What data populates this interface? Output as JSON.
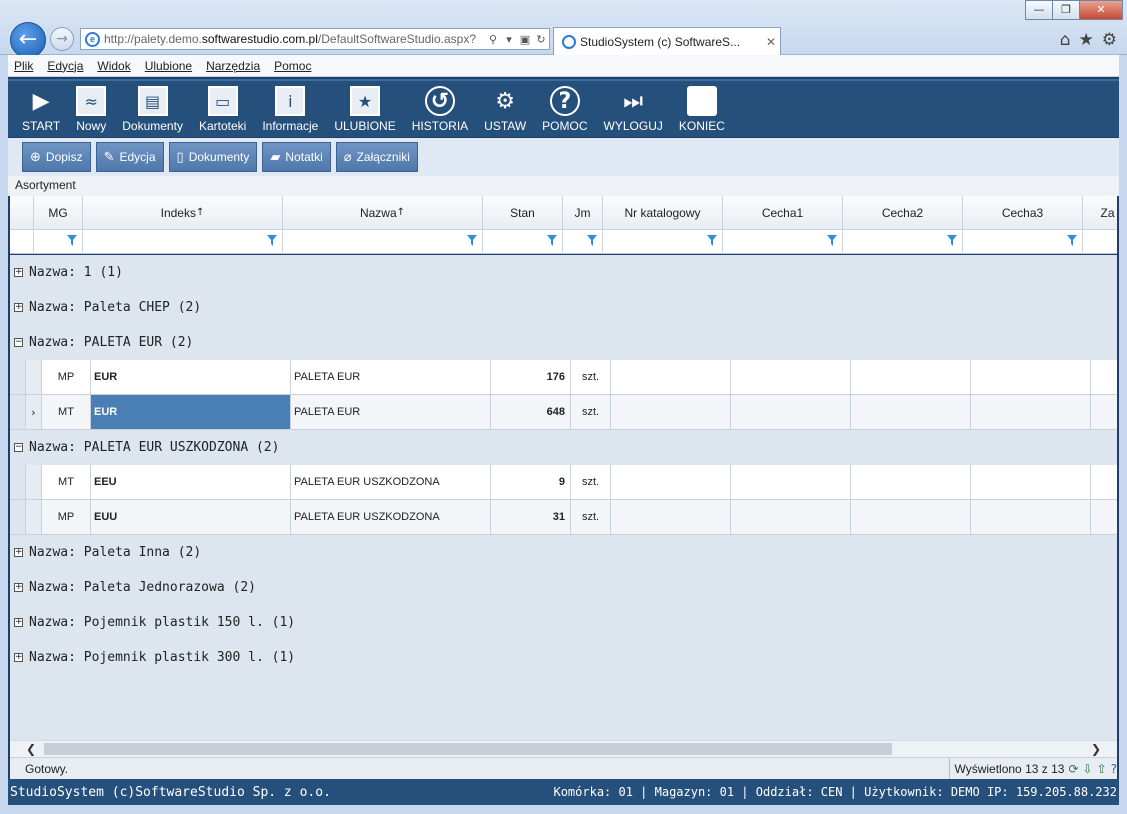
{
  "browser": {
    "url_prefix": "http://palety.demo.",
    "url_domain": "softwarestudio.com.pl",
    "url_path": "/DefaultSoftwareStudio.aspx?",
    "tab_title": "StudioSystem (c) SoftwareS...",
    "tab_close": "✕",
    "window_buttons": [
      "—",
      "❐",
      "✕"
    ]
  },
  "menu": [
    "Plik",
    "Edycja",
    "Widok",
    "Ulubione",
    "Narzędzia",
    "Pomoc"
  ],
  "toolbar": [
    {
      "label": "START",
      "icon": "▶"
    },
    {
      "label": "Nowy",
      "icon": "≈"
    },
    {
      "label": "Dokumenty",
      "icon": "▤"
    },
    {
      "label": "Kartoteki",
      "icon": "▭"
    },
    {
      "label": "Informacje",
      "icon": "i"
    },
    {
      "label": "ULUBIONE",
      "icon": "★"
    },
    {
      "label": "HISTORIA",
      "icon": "↺"
    },
    {
      "label": "USTAW",
      "icon": "⚙"
    },
    {
      "label": "POMOC",
      "icon": "?"
    },
    {
      "label": "WYLOGUJ",
      "icon": "⏭"
    },
    {
      "label": "KONIEC",
      "icon": ""
    }
  ],
  "subtoolbar": [
    {
      "label": "Dopisz",
      "icon": "⊕"
    },
    {
      "label": "Edycja",
      "icon": "✎"
    },
    {
      "label": "Dokumenty",
      "icon": "▯"
    },
    {
      "label": "Notatki",
      "icon": "▰"
    },
    {
      "label": "Załączniki",
      "icon": "⌀"
    }
  ],
  "section_title": "Asortyment",
  "columns": [
    {
      "label": "",
      "w": 24
    },
    {
      "label": "MG",
      "w": 49
    },
    {
      "label": "Indeks",
      "w": 200
    },
    {
      "label": "Nazwa",
      "w": 200
    },
    {
      "label": "Stan",
      "w": 80
    },
    {
      "label": "Jm",
      "w": 40
    },
    {
      "label": "Nr katalogowy",
      "w": 120
    },
    {
      "label": "Cecha1",
      "w": 120
    },
    {
      "label": "Cecha2",
      "w": 120
    },
    {
      "label": "Cecha3",
      "w": 120
    },
    {
      "label": "Za",
      "w": 50
    }
  ],
  "groups": [
    {
      "label": "Nazwa: 1 (1)",
      "expanded": false,
      "rows": []
    },
    {
      "label": "Nazwa: Paleta CHEP (2)",
      "expanded": false,
      "rows": []
    },
    {
      "label": "Nazwa: PALETA EUR (2)",
      "expanded": true,
      "rows": [
        {
          "mg": "MP",
          "indeks": "EUR",
          "nazwa": "PALETA EUR",
          "stan": "176",
          "jm": "szt.",
          "current": false,
          "selected": false
        },
        {
          "mg": "MT",
          "indeks": "EUR",
          "nazwa": "PALETA EUR",
          "stan": "648",
          "jm": "szt.",
          "current": true,
          "selected": true
        }
      ]
    },
    {
      "label": "Nazwa: PALETA EUR USZKODZONA (2)",
      "expanded": true,
      "rows": [
        {
          "mg": "MT",
          "indeks": "EEU",
          "nazwa": "PALETA EUR USZKODZONA",
          "stan": "9",
          "jm": "szt.",
          "current": false,
          "selected": false
        },
        {
          "mg": "MP",
          "indeks": "EUU",
          "nazwa": "PALETA EUR USZKODZONA",
          "stan": "31",
          "jm": "szt.",
          "current": false,
          "selected": false
        }
      ]
    },
    {
      "label": "Nazwa: Paleta Inna (2)",
      "expanded": false,
      "rows": []
    },
    {
      "label": "Nazwa: Paleta Jednorazowa (2)",
      "expanded": false,
      "rows": []
    },
    {
      "label": "Nazwa: Pojemnik plastik 150 l. (1)",
      "expanded": false,
      "rows": []
    },
    {
      "label": "Nazwa: Pojemnik plastik 300 l. (1)",
      "expanded": false,
      "rows": []
    }
  ],
  "status": {
    "left": "Gotowy.",
    "right": "Wyświetlono 13 z 13"
  },
  "footer": {
    "left": "StudioSystem (c)SoftwareStudio Sp. z o.o.",
    "right": "Komórka: 01 | Magazyn: 01 | Oddział: CEN | Użytkownik: DEMO IP: 159.205.88.232"
  },
  "colors": {
    "toolbar_bg": "#26507c",
    "selected_cell": "#4a7fb5",
    "group_bg": "#dde5ef"
  }
}
